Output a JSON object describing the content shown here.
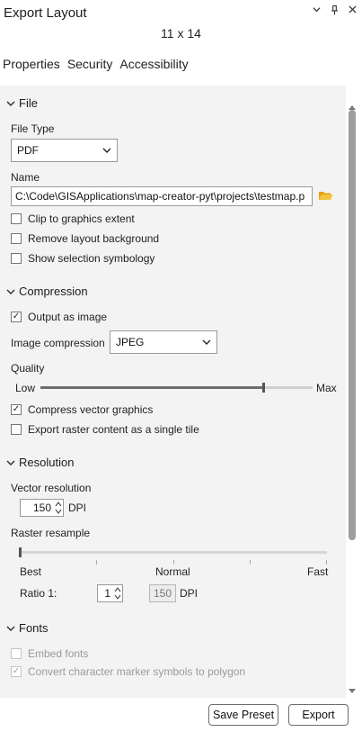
{
  "window": {
    "title": "Export Layout",
    "subtitle": "11 x 14",
    "controls": [
      "chevron-down-icon",
      "pin-icon",
      "close-icon"
    ]
  },
  "tabs": [
    {
      "label": "Properties"
    },
    {
      "label": "Security"
    },
    {
      "label": "Accessibility"
    }
  ],
  "file": {
    "header": "File",
    "file_type_label": "File Type",
    "file_type_value": "PDF",
    "name_label": "Name",
    "name_value": "C:\\Code\\GISApplications\\map-creator-pyt\\projects\\testmap.p",
    "checkboxes": [
      {
        "label": "Clip to graphics extent",
        "checked": false
      },
      {
        "label": "Remove layout background",
        "checked": false
      },
      {
        "label": "Show selection symbology",
        "checked": false
      }
    ]
  },
  "compression": {
    "header": "Compression",
    "output_as_image": {
      "label": "Output as image",
      "checked": true
    },
    "image_compression_label": "Image compression",
    "image_compression_value": "JPEG",
    "quality_label": "Quality",
    "quality_low": "Low",
    "quality_max": "Max",
    "quality_fraction": 0.82,
    "compress_vector": {
      "label": "Compress vector graphics",
      "checked": true
    },
    "export_raster_tile": {
      "label": "Export raster content as a single tile",
      "checked": false
    }
  },
  "resolution": {
    "header": "Resolution",
    "vector_label": "Vector resolution",
    "vector_value": "150",
    "dpi_unit": "DPI",
    "raster_label": "Raster resample",
    "resample_best": "Best",
    "resample_normal": "Normal",
    "resample_fast": "Fast",
    "ratio_label": "Ratio 1:",
    "ratio_value": "1",
    "raster_dpi_value": "150",
    "raster_dpi_unit": "DPI"
  },
  "fonts": {
    "header": "Fonts",
    "embed_fonts": {
      "label": "Embed fonts",
      "checked": false
    },
    "convert_markers": {
      "label": "Convert character marker symbols to polygon",
      "checked": true
    }
  },
  "footer": {
    "save_preset_label": "Save Preset",
    "export_label": "Export"
  },
  "colors": {
    "panel_bg": "#f3f3f3",
    "folder_icon": "#e2a100"
  }
}
